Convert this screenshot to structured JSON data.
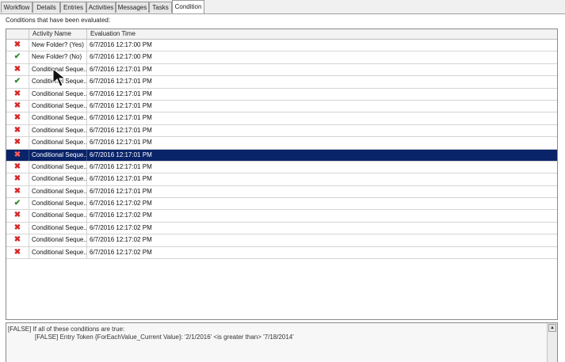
{
  "tabs": [
    "Workflow",
    "Details",
    "Entries",
    "Activities",
    "Messages",
    "Tasks",
    "Condition"
  ],
  "active_tab": "Condition",
  "panel_title": "Conditions that have been evaluated:",
  "grid": {
    "columns": [
      "",
      "Activity Name",
      "Evaluation Time"
    ],
    "rows": [
      {
        "status": "x",
        "name": "New Folder? (Yes)",
        "time": "6/7/2016 12:17:00 PM"
      },
      {
        "status": "check",
        "name": "New Folder? (No)",
        "time": "6/7/2016 12:17:00 PM"
      },
      {
        "status": "x",
        "name": "Conditional Seque...",
        "time": "6/7/2016 12:17:01 PM"
      },
      {
        "status": "check",
        "name": "Conditional Seque...",
        "time": "6/7/2016 12:17:01 PM"
      },
      {
        "status": "x",
        "name": "Conditional Seque...",
        "time": "6/7/2016 12:17:01 PM"
      },
      {
        "status": "x",
        "name": "Conditional Seque...",
        "time": "6/7/2016 12:17:01 PM"
      },
      {
        "status": "x",
        "name": "Conditional Seque...",
        "time": "6/7/2016 12:17:01 PM"
      },
      {
        "status": "x",
        "name": "Conditional Seque...",
        "time": "6/7/2016 12:17:01 PM"
      },
      {
        "status": "x",
        "name": "Conditional Seque...",
        "time": "6/7/2016 12:17:01 PM"
      },
      {
        "status": "x",
        "name": "Conditional Seque...",
        "time": "6/7/2016 12:17:01 PM",
        "selected": true
      },
      {
        "status": "x",
        "name": "Conditional Seque...",
        "time": "6/7/2016 12:17:01 PM"
      },
      {
        "status": "x",
        "name": "Conditional Seque...",
        "time": "6/7/2016 12:17:01 PM"
      },
      {
        "status": "x",
        "name": "Conditional Seque...",
        "time": "6/7/2016 12:17:01 PM"
      },
      {
        "status": "check",
        "name": "Conditional Seque...",
        "time": "6/7/2016 12:17:02 PM"
      },
      {
        "status": "x",
        "name": "Conditional Seque...",
        "time": "6/7/2016 12:17:02 PM"
      },
      {
        "status": "x",
        "name": "Conditional Seque...",
        "time": "6/7/2016 12:17:02 PM"
      },
      {
        "status": "x",
        "name": "Conditional Seque...",
        "time": "6/7/2016 12:17:02 PM"
      },
      {
        "status": "x",
        "name": "Conditional Seque...",
        "time": "6/7/2016 12:17:02 PM"
      }
    ]
  },
  "details": {
    "line1": "[FALSE] If all of these conditions are true:",
    "line2": "[FALSE] Entry Token {ForEachValue_Current Value}: '2/1/2016' <is greater than> '7/18/2014'"
  },
  "icons": {
    "fail": "x-icon",
    "pass": "check-icon",
    "scroll_up": "arrow-up-icon",
    "cursor": "mouse-pointer-icon"
  },
  "colors": {
    "selected_row": "#0a246a",
    "fail": "#d42a2a",
    "pass": "#2e8b2e"
  }
}
